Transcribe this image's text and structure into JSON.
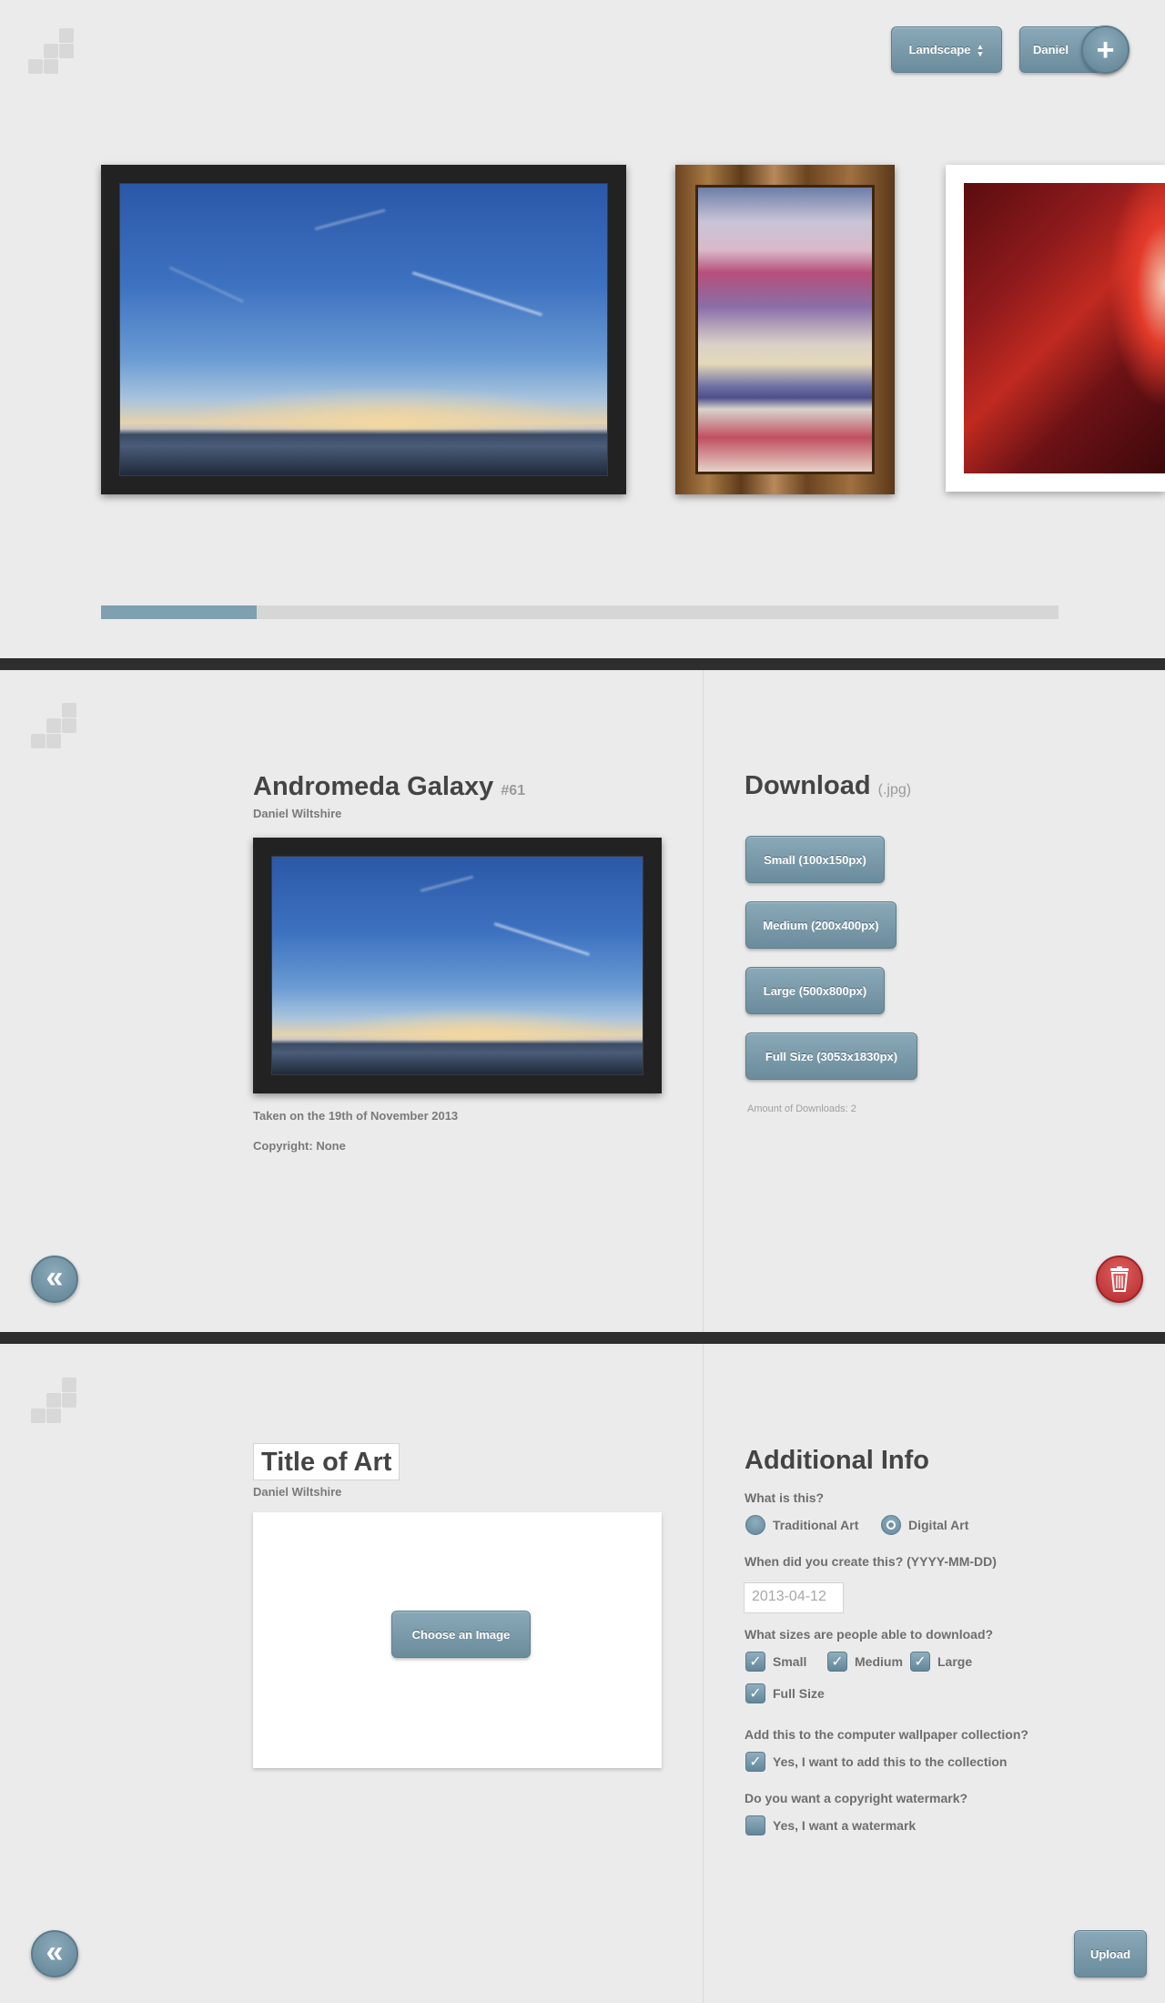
{
  "header": {
    "orientation_label": "Landscape",
    "orientation_icon": "updown-icon",
    "user_label": "Daniel",
    "add_icon": "plus-icon"
  },
  "gallery": {
    "progress": 0.163,
    "items": [
      "night-sky-photo",
      "watercolor-painting",
      "canyon-photo"
    ]
  },
  "detail": {
    "title": "Andromeda Galaxy",
    "number": "#61",
    "artist": "Daniel Wiltshire",
    "taken": "Taken on the 19th of November 2013",
    "copyright": "Copyright: None",
    "download_title": "Download",
    "download_ext": "(.jpg)",
    "buttons": {
      "small": "Small (100x150px)",
      "medium": "Medium (200x400px)",
      "large": "Large (500x800px)",
      "full": "Full Size (3053x1830px)"
    },
    "downloads_count": "Amount of Downloads: 2",
    "back_icon": "double-chevron-left-icon",
    "delete_icon": "trash-icon"
  },
  "upload": {
    "title_value": "Title of Art",
    "artist": "Daniel Wiltshire",
    "choose_label": "Choose an Image",
    "info_title": "Additional Info",
    "q_type": "What is this?",
    "type_options": {
      "traditional": "Traditional Art",
      "digital": "Digital Art"
    },
    "selected_type": "Digital Art",
    "q_date": "When did you create this? (YYYY-MM-DD)",
    "date_placeholder": "2013-04-12",
    "q_sizes": "What sizes are people able to download?",
    "sizes": {
      "small": "Small",
      "medium": "Medium",
      "large": "Large",
      "full": "Full Size"
    },
    "q_wallpaper": "Add this to the computer wallpaper collection?",
    "wallpaper_option": "Yes, I want to add this to the collection",
    "q_watermark": "Do you want a copyright watermark?",
    "watermark_option": "Yes, I want a watermark",
    "upload_label": "Upload",
    "back_icon": "double-chevron-left-icon"
  },
  "colors": {
    "accent": "#7fa0b0",
    "divider": "#2e2e2e",
    "delete": "#c33a3a",
    "background": "#ebebeb"
  }
}
